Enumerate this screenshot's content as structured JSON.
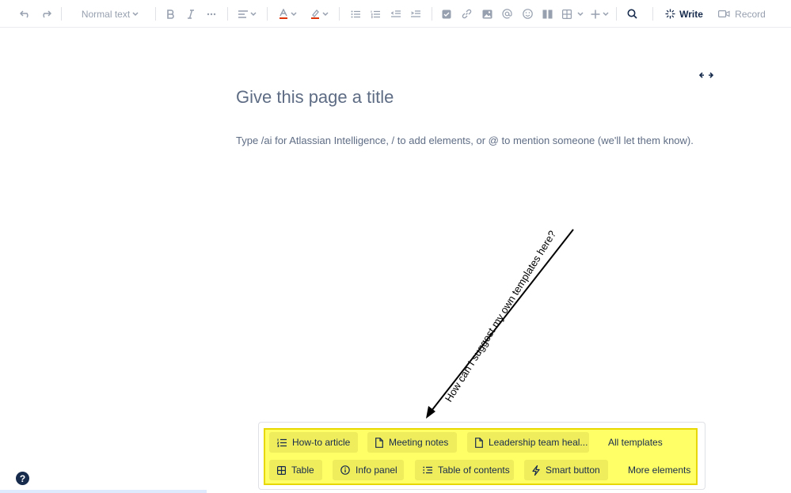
{
  "toolbar": {
    "text_style": "Normal text",
    "write_label": "Write",
    "record_label": "Record",
    "icons": [
      "undo-icon",
      "redo-icon",
      "bold-icon",
      "italic-icon",
      "more-formatting-icon",
      "align-icon",
      "text-color-icon",
      "highlight-icon",
      "bullet-list-icon",
      "numbered-list-icon",
      "outdent-icon",
      "indent-icon",
      "task-icon",
      "link-icon",
      "image-icon",
      "mention-icon",
      "emoji-icon",
      "layout-icon",
      "table-icon",
      "insert-icon",
      "search-icon",
      "ai-write-icon",
      "record-icon"
    ]
  },
  "page": {
    "title_placeholder": "Give this page a title",
    "body_placeholder": "Type /ai for Atlassian Intelligence, / to add elements, or @ to mention someone (we'll let them know)."
  },
  "annotation": {
    "text": "How can I suggest my own templates here?"
  },
  "quick_insert": {
    "templates": [
      {
        "label": "How-to article",
        "icon": "list-icon"
      },
      {
        "label": "Meeting notes",
        "icon": "page-icon"
      },
      {
        "label": "Leadership team heal...",
        "icon": "page-icon"
      },
      {
        "label": "All templates",
        "icon": ""
      }
    ],
    "elements": [
      {
        "label": "Table",
        "icon": "table-icon"
      },
      {
        "label": "Info panel",
        "icon": "info-icon"
      },
      {
        "label": "Table of contents",
        "icon": "toc-icon"
      },
      {
        "label": "Smart button",
        "icon": "lightning-icon"
      },
      {
        "label": "More elements",
        "icon": ""
      }
    ]
  },
  "help": {
    "label": "?"
  },
  "colors": {
    "highlight": "#ffff66",
    "chip": "#f0ed5c",
    "text": "#172b4d",
    "muted": "#97a0af"
  }
}
